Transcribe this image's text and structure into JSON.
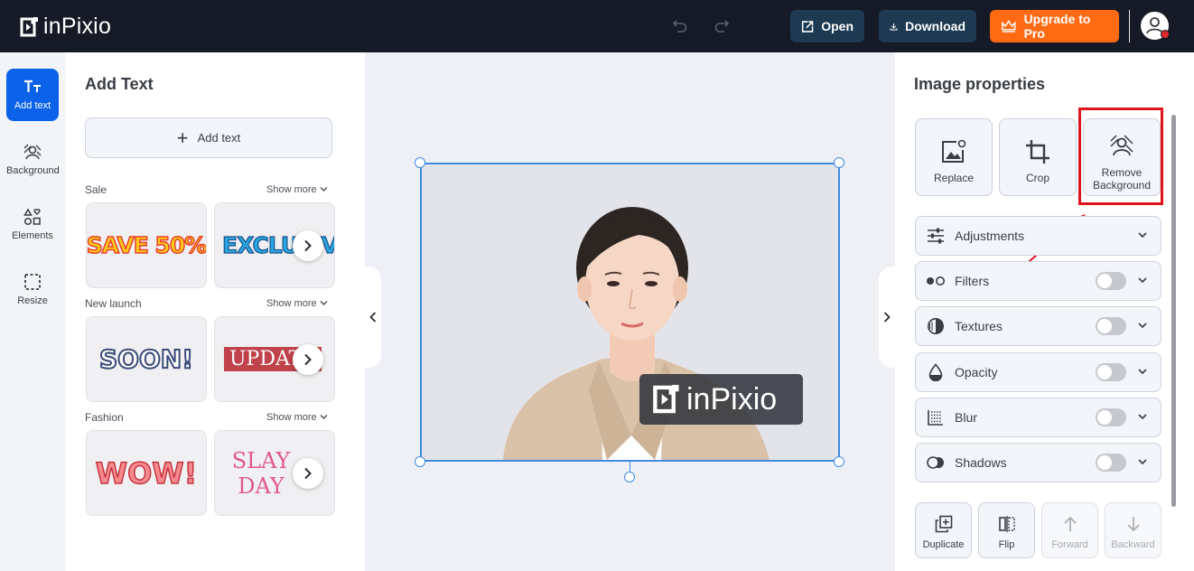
{
  "header": {
    "logo_text": "inPixio",
    "open_label": "Open",
    "download_label": "Download",
    "upgrade_label": "Upgrade to Pro"
  },
  "rail": [
    {
      "label": "Add text",
      "icon": "text-icon",
      "active": true
    },
    {
      "label": "Background",
      "icon": "background-icon"
    },
    {
      "label": "Elements",
      "icon": "elements-icon"
    },
    {
      "label": "Resize",
      "icon": "resize-icon"
    }
  ],
  "left_panel": {
    "title": "Add Text",
    "add_text_label": "Add text",
    "sections": [
      {
        "label": "Sale",
        "show_more": "Show more",
        "tiles": [
          "SAVE 50%",
          "EXCLUSIVE"
        ]
      },
      {
        "label": "New launch",
        "show_more": "Show more",
        "tiles": [
          "SOON!",
          "UPDATE"
        ]
      },
      {
        "label": "Fashion",
        "show_more": "Show more",
        "tiles": [
          "WOW!",
          "SLAY DAY"
        ]
      }
    ]
  },
  "canvas": {
    "watermark_text": "inPixio"
  },
  "right_panel": {
    "title": "Image properties",
    "tools": [
      {
        "label": "Replace",
        "icon": "replace-image-icon"
      },
      {
        "label": "Crop",
        "icon": "crop-icon"
      },
      {
        "label": "Remove Background",
        "icon": "remove-background-icon"
      }
    ],
    "properties": [
      {
        "label": "Adjustments",
        "icon": "sliders-icon",
        "toggle": false
      },
      {
        "label": "Filters",
        "icon": "filters-icon",
        "toggle": true,
        "enabled": false
      },
      {
        "label": "Textures",
        "icon": "textures-icon",
        "toggle": true,
        "enabled": false
      },
      {
        "label": "Opacity",
        "icon": "opacity-icon",
        "toggle": true,
        "enabled": false
      },
      {
        "label": "Blur",
        "icon": "blur-icon",
        "toggle": true,
        "enabled": false
      },
      {
        "label": "Shadows",
        "icon": "shadows-icon",
        "toggle": true,
        "enabled": false
      }
    ],
    "bottom_tools": [
      {
        "label": "Duplicate",
        "icon": "duplicate-icon",
        "enabled": true
      },
      {
        "label": "Flip",
        "icon": "flip-icon",
        "enabled": true
      },
      {
        "label": "Forward",
        "icon": "arrow-up-icon",
        "enabled": false
      },
      {
        "label": "Backward",
        "icon": "arrow-down-icon",
        "enabled": false
      }
    ]
  },
  "colors": {
    "header_bg": "#151a26",
    "accent_blue": "#0b62e8",
    "upgrade_orange": "#ff6a13",
    "highlight_red": "#e0141b"
  }
}
